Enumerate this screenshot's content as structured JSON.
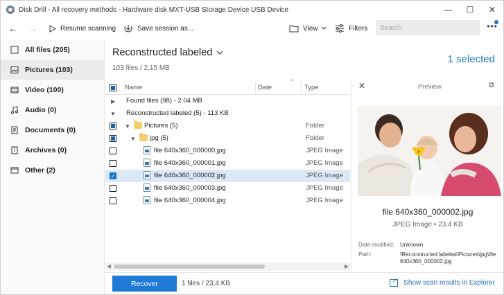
{
  "window": {
    "title": "Disk Drill - All recovery methods - Hardware disk MXT-USB Storage Device USB Device",
    "minimize": "—",
    "maximize": "☐",
    "close": "✕"
  },
  "toolbar": {
    "back_icon": "←",
    "forward_icon": "→",
    "resume_label": "Resume scanning",
    "save_label": "Save session as...",
    "view_label": "View",
    "filters_label": "Filters",
    "search_placeholder": "Search",
    "more_label": "•••"
  },
  "sidebar": {
    "items": [
      {
        "label": "All files (205)",
        "icon": "all-files-icon",
        "active": false
      },
      {
        "label": "Pictures (103)",
        "icon": "picture-icon",
        "active": true
      },
      {
        "label": "Video (100)",
        "icon": "video-icon",
        "active": false
      },
      {
        "label": "Audio (0)",
        "icon": "music-icon",
        "active": false
      },
      {
        "label": "Documents (0)",
        "icon": "document-icon",
        "active": false
      },
      {
        "label": "Archives (0)",
        "icon": "archive-icon",
        "active": false
      },
      {
        "label": "Other (2)",
        "icon": "other-icon",
        "active": false
      }
    ]
  },
  "main": {
    "title": "Reconstructed labeled",
    "subtitle": "103 files / 2,15 MB",
    "selected": "1 selected"
  },
  "table": {
    "columns": {
      "name": "Name",
      "date": "Date",
      "type": "Type"
    },
    "rows": [
      {
        "name": "Found files (98) - 2.04 MB",
        "type": "",
        "kind": "group-collapsed"
      },
      {
        "name": "Reconstructed labeled (5) - 113 KB",
        "type": "",
        "kind": "group-expanded"
      },
      {
        "name": "Pictures (5)",
        "type": "Folder",
        "kind": "folder"
      },
      {
        "name": "jpg (5)",
        "type": "Folder",
        "kind": "subfolder"
      },
      {
        "name": "file 640x360_000000.jpg",
        "type": "JPEG Image",
        "kind": "file",
        "checked": false
      },
      {
        "name": "file 640x360_000001.jpg",
        "type": "JPEG Image",
        "kind": "file",
        "checked": false
      },
      {
        "name": "file 640x360_000002.jpg",
        "type": "JPEG Image",
        "kind": "file",
        "checked": true
      },
      {
        "name": "file 640x360_000003.jpg",
        "type": "JPEG Image",
        "kind": "file",
        "checked": false
      },
      {
        "name": "file 640x360_000004.jpg",
        "type": "JPEG Image",
        "kind": "file",
        "checked": false
      }
    ]
  },
  "preview": {
    "title": "Preview",
    "file_name": "file 640x360_000002.jpg",
    "file_meta": "JPEG Image • 23,4 KB",
    "date_modified_label": "Date modified:",
    "date_modified_value": "Unknown",
    "path_label": "Path:",
    "path_value": "\\Reconstructed labeled\\Pictures\\jpg\\file 640x360_000002.jpg"
  },
  "footer": {
    "recover_label": "Recover",
    "info": "1 files / 23,4 KB",
    "explorer_link": "Show scan results in Explorer"
  },
  "colors": {
    "accent": "#1f7ad6",
    "selected_row": "#dbe9f7",
    "folder": "#f3cf6b"
  }
}
